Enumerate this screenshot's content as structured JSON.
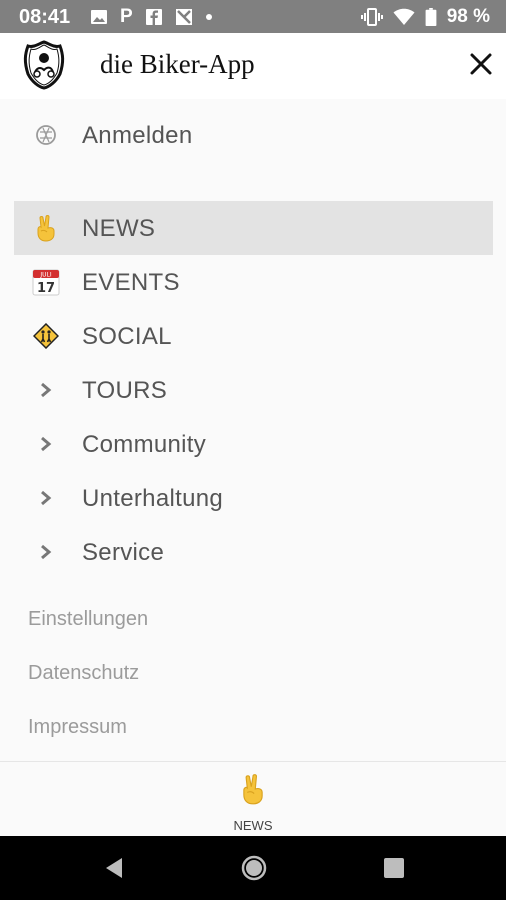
{
  "status_bar": {
    "time": "08:41",
    "battery_percent": "98 %",
    "notification_p": "P",
    "icons": [
      "image-icon",
      "parking-icon",
      "facebook-icon",
      "gallery-icon",
      "dot-icon",
      "vibrate-icon",
      "wifi-icon",
      "battery-icon"
    ]
  },
  "header": {
    "title": "die Biker-App",
    "close_icon": "close-icon"
  },
  "login": {
    "label": "Anmelden",
    "icon": "login-icon"
  },
  "menu": {
    "items": [
      {
        "label": "NEWS",
        "icon": "peace-hand-icon",
        "active": true
      },
      {
        "label": "EVENTS",
        "icon": "calendar-icon",
        "active": false
      },
      {
        "label": "SOCIAL",
        "icon": "warning-sign-icon",
        "active": false
      },
      {
        "label": "TOURS",
        "icon": "chevron-right-icon",
        "active": false
      },
      {
        "label": "Community",
        "icon": "chevron-right-icon",
        "active": false
      },
      {
        "label": "Unterhaltung",
        "icon": "chevron-right-icon",
        "active": false
      },
      {
        "label": "Service",
        "icon": "chevron-right-icon",
        "active": false
      }
    ]
  },
  "calendar_icon_text": {
    "month": "JULI",
    "day": "17"
  },
  "footer_links": {
    "items": [
      {
        "label": "Einstellungen"
      },
      {
        "label": "Datenschutz"
      },
      {
        "label": "Impressum"
      }
    ]
  },
  "tab_bar": {
    "news_label": "NEWS"
  },
  "colors": {
    "status_bar": "#808080",
    "active_row": "#e3e3e3",
    "menu_text": "#555555",
    "footer_text": "#9b9b9b",
    "emoji_yellow": "#f5c33b"
  }
}
